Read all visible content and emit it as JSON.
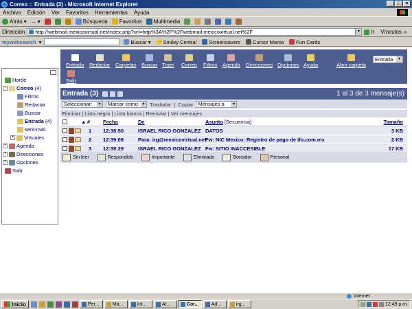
{
  "window": {
    "title": "Correo :: Entrada (3) - Microsoft Internet Explorer"
  },
  "menubar": [
    "Archivo",
    "Edición",
    "Ver",
    "Favoritos",
    "Herramientas",
    "Ayuda"
  ],
  "toolbar": {
    "back": "Atrás",
    "search": "Búsqueda",
    "favorites": "Favoritos",
    "multimedia": "Multimedia"
  },
  "address": {
    "label": "Dirección",
    "url": "http://webmail.mexicovirtual.net/index.php?url=http%3A%2F%2Fwebmail.mexicovirtual.net%2F",
    "go": "Ir",
    "links": "Vínculos"
  },
  "mywebsearch": {
    "logo": "mywebsearch",
    "search_btn": "Buscar",
    "items": [
      "Smiley Central",
      "Screensavers",
      "Cursor Mania",
      "Fun Cards"
    ]
  },
  "tree": {
    "items": [
      "Horde",
      "Correo",
      "(4)",
      "Filtros",
      "Redactar",
      "Buscar",
      "Entrada",
      "(4)",
      "sent-mail",
      "Virtuales",
      "Agenda",
      "Direcciones",
      "Opciones",
      "Salir"
    ]
  },
  "nav": {
    "items": [
      "Entrada",
      "Redactar",
      "Carpetas",
      "Buscar",
      "Traer",
      "Correo",
      "Filtros",
      "Agenda",
      "Direcciones",
      "Opciones",
      "Ayuda",
      "Abrir carpeta",
      "Salir"
    ],
    "folder_select": "Entrada"
  },
  "mailbox": {
    "title": "Entrada (3)",
    "count": "1 al 3 de 3 mensaje(s)"
  },
  "actions": {
    "select": "Seleccionar:",
    "mark": "Marcar como:",
    "move": "Trasladar",
    "copy": "Copiar",
    "messages_to": "Mensajes a",
    "links": "Eliminar | Lista negra | Lista blanca | Reenviar | Ver mensajes"
  },
  "table": {
    "headers": {
      "sort": "▲",
      "num": "#",
      "date": "Fecha",
      "from": "De",
      "subject": "Asunto",
      "sequence": "[Secuencia]",
      "size": "Tamaño"
    },
    "rows": [
      {
        "num": "1",
        "time": "12:38:50",
        "from": "ISRAEL RICO GONZALEZ",
        "subject": "DATOS",
        "size": "3 KB"
      },
      {
        "num": "2",
        "time": "12:39:08",
        "from": "Para: irg@mexicovirtual.net",
        "subject": "Fw: NIC Mexico: Registro de pago de ifo.com.mx",
        "size": "2 KB"
      },
      {
        "num": "3",
        "time": "12:39:29",
        "from": "ISRAEL RICO GONZALEZ",
        "subject": "Fw: SITIO INACCESIBLE",
        "size": "17 KB"
      }
    ]
  },
  "legend": [
    "Sin leer",
    "Respondido",
    "Importante",
    "Eliminado",
    "Borrador",
    "Personal"
  ],
  "statusbar": {
    "zone": "Internet"
  },
  "taskbar": {
    "start": "Inicio",
    "tasks": [
      "Per...",
      "Ma...",
      "Int...",
      "At...",
      "Cor...",
      "Ad...",
      "irg..."
    ],
    "clock": "12:49 p.m."
  }
}
